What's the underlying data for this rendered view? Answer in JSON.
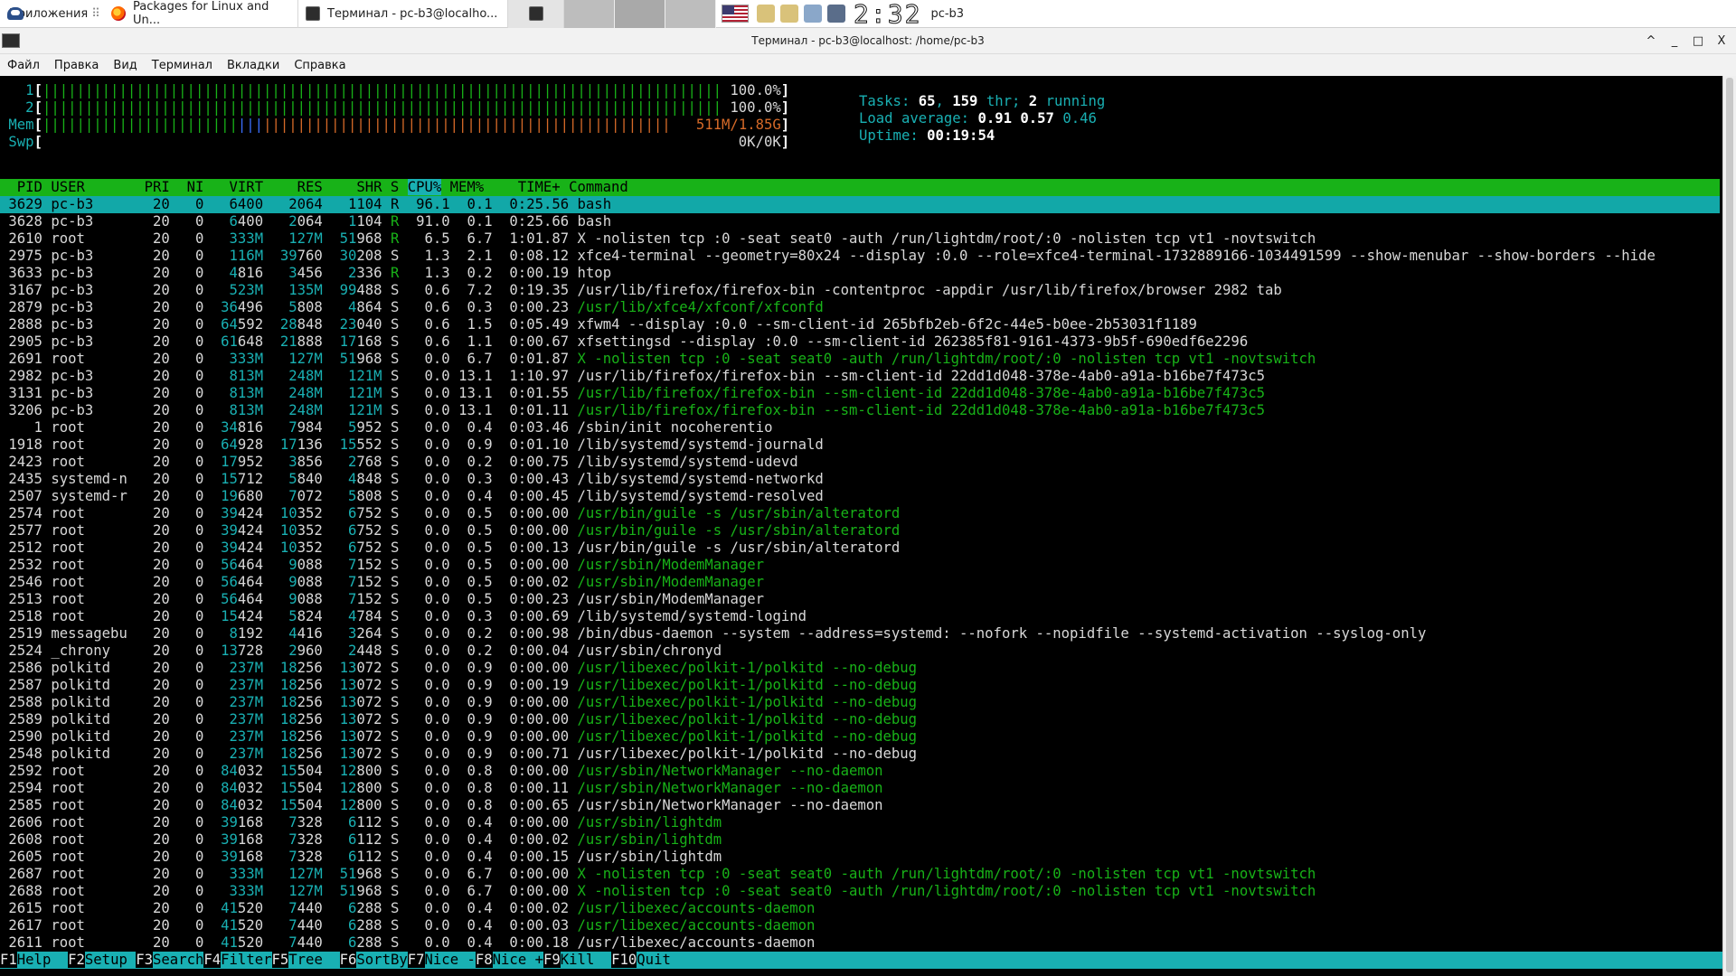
{
  "panel": {
    "apps_label": "Приложения",
    "tasks": [
      {
        "label": "Packages for Linux and Un...",
        "icon": "firefox-icon"
      },
      {
        "label": "Терминал - pc-b3@localho...",
        "icon": "terminal-icon"
      }
    ],
    "clock": "2:32",
    "user": "pc-b3"
  },
  "window": {
    "title": "Терминал - pc-b3@localhost: /home/pc-b3",
    "controls": [
      "^",
      "_",
      "□",
      "X"
    ]
  },
  "menu": [
    "Файл",
    "Правка",
    "Вид",
    "Терминал",
    "Вкладки",
    "Справка"
  ],
  "htop": {
    "cpu1": {
      "label": "1",
      "value": "100.0%"
    },
    "cpu2": {
      "label": "2",
      "value": "100.0%"
    },
    "mem": {
      "label": "Mem",
      "value": "511M/1.85G"
    },
    "swp": {
      "label": "Swp",
      "value": "0K/0K"
    },
    "tasks": "65",
    "threads": "159",
    "running": "2",
    "load1": "0.91",
    "load5": "0.57",
    "load15": "0.46",
    "uptime": "00:19:54",
    "columns": [
      "PID",
      "USER",
      "PRI",
      "NI",
      "VIRT",
      "RES",
      "SHR",
      "S",
      "CPU%",
      "MEM%",
      "TIME+",
      "Command"
    ],
    "processes": [
      {
        "pid": "3629",
        "user": "pc-b3",
        "pri": "20",
        "ni": "0",
        "virt": "6400",
        "res": "2064",
        "shr": "1104",
        "s": "R",
        "cpu": "96.1",
        "mem": "0.1",
        "time": "0:25.56",
        "cmd": "bash",
        "thread": false
      },
      {
        "pid": "3628",
        "user": "pc-b3",
        "pri": "20",
        "ni": "0",
        "virt": "6400",
        "res": "2064",
        "shr": "1104",
        "s": "R",
        "cpu": "91.0",
        "mem": "0.1",
        "time": "0:25.66",
        "cmd": "bash",
        "thread": false
      },
      {
        "pid": "2610",
        "user": "root",
        "pri": "20",
        "ni": "0",
        "virt": "333M",
        "res": "127M",
        "shr": "51968",
        "s": "R",
        "cpu": "6.5",
        "mem": "6.7",
        "time": "1:01.87",
        "cmd": "X -nolisten tcp :0 -seat seat0 -auth /run/lightdm/root/:0 -nolisten tcp vt1 -novtswitch",
        "thread": false
      },
      {
        "pid": "2975",
        "user": "pc-b3",
        "pri": "20",
        "ni": "0",
        "virt": "116M",
        "res": "39760",
        "shr": "30208",
        "s": "S",
        "cpu": "1.3",
        "mem": "2.1",
        "time": "0:08.12",
        "cmd": "xfce4-terminal --geometry=80x24 --display :0.0 --role=xfce4-terminal-1732889166-1034491599 --show-menubar --show-borders --hide",
        "thread": false
      },
      {
        "pid": "3633",
        "user": "pc-b3",
        "pri": "20",
        "ni": "0",
        "virt": "4816",
        "res": "3456",
        "shr": "2336",
        "s": "R",
        "cpu": "1.3",
        "mem": "0.2",
        "time": "0:00.19",
        "cmd": "htop",
        "thread": false
      },
      {
        "pid": "3167",
        "user": "pc-b3",
        "pri": "20",
        "ni": "0",
        "virt": "523M",
        "res": "135M",
        "shr": "99488",
        "s": "S",
        "cpu": "0.6",
        "mem": "7.2",
        "time": "0:19.35",
        "cmd": "/usr/lib/firefox/firefox-bin -contentproc -appdir /usr/lib/firefox/browser 2982 tab",
        "thread": false
      },
      {
        "pid": "2879",
        "user": "pc-b3",
        "pri": "20",
        "ni": "0",
        "virt": "36496",
        "res": "5808",
        "shr": "4864",
        "s": "S",
        "cpu": "0.6",
        "mem": "0.3",
        "time": "0:00.23",
        "cmd": "/usr/lib/xfce4/xfconf/xfconfd",
        "thread": true
      },
      {
        "pid": "2888",
        "user": "pc-b3",
        "pri": "20",
        "ni": "0",
        "virt": "64592",
        "res": "28848",
        "shr": "23040",
        "s": "S",
        "cpu": "0.6",
        "mem": "1.5",
        "time": "0:05.49",
        "cmd": "xfwm4 --display :0.0 --sm-client-id 265bfb2eb-6f2c-44e5-b0ee-2b53031f1189",
        "thread": false
      },
      {
        "pid": "2905",
        "user": "pc-b3",
        "pri": "20",
        "ni": "0",
        "virt": "61648",
        "res": "21888",
        "shr": "17168",
        "s": "S",
        "cpu": "0.6",
        "mem": "1.1",
        "time": "0:00.67",
        "cmd": "xfsettingsd --display :0.0 --sm-client-id 262385f81-9161-4373-9b5f-690edf6e2296",
        "thread": false
      },
      {
        "pid": "2691",
        "user": "root",
        "pri": "20",
        "ni": "0",
        "virt": "333M",
        "res": "127M",
        "shr": "51968",
        "s": "S",
        "cpu": "0.0",
        "mem": "6.7",
        "time": "0:01.87",
        "cmd": "X -nolisten tcp :0 -seat seat0 -auth /run/lightdm/root/:0 -nolisten tcp vt1 -novtswitch",
        "thread": true
      },
      {
        "pid": "2982",
        "user": "pc-b3",
        "pri": "20",
        "ni": "0",
        "virt": "813M",
        "res": "248M",
        "shr": "121M",
        "s": "S",
        "cpu": "0.0",
        "mem": "13.1",
        "time": "1:10.97",
        "cmd": "/usr/lib/firefox/firefox-bin --sm-client-id 22dd1d048-378e-4ab0-a91a-b16be7f473c5",
        "thread": false
      },
      {
        "pid": "3131",
        "user": "pc-b3",
        "pri": "20",
        "ni": "0",
        "virt": "813M",
        "res": "248M",
        "shr": "121M",
        "s": "S",
        "cpu": "0.0",
        "mem": "13.1",
        "time": "0:01.55",
        "cmd": "/usr/lib/firefox/firefox-bin --sm-client-id 22dd1d048-378e-4ab0-a91a-b16be7f473c5",
        "thread": true
      },
      {
        "pid": "3206",
        "user": "pc-b3",
        "pri": "20",
        "ni": "0",
        "virt": "813M",
        "res": "248M",
        "shr": "121M",
        "s": "S",
        "cpu": "0.0",
        "mem": "13.1",
        "time": "0:01.11",
        "cmd": "/usr/lib/firefox/firefox-bin --sm-client-id 22dd1d048-378e-4ab0-a91a-b16be7f473c5",
        "thread": true
      },
      {
        "pid": "1",
        "user": "root",
        "pri": "20",
        "ni": "0",
        "virt": "34816",
        "res": "7984",
        "shr": "5952",
        "s": "S",
        "cpu": "0.0",
        "mem": "0.4",
        "time": "0:03.46",
        "cmd": "/sbin/init nocoherentio",
        "thread": false
      },
      {
        "pid": "1918",
        "user": "root",
        "pri": "20",
        "ni": "0",
        "virt": "64928",
        "res": "17136",
        "shr": "15552",
        "s": "S",
        "cpu": "0.0",
        "mem": "0.9",
        "time": "0:01.10",
        "cmd": "/lib/systemd/systemd-journald",
        "thread": false
      },
      {
        "pid": "2423",
        "user": "root",
        "pri": "20",
        "ni": "0",
        "virt": "17952",
        "res": "3856",
        "shr": "2768",
        "s": "S",
        "cpu": "0.0",
        "mem": "0.2",
        "time": "0:00.75",
        "cmd": "/lib/systemd/systemd-udevd",
        "thread": false
      },
      {
        "pid": "2435",
        "user": "systemd-n",
        "pri": "20",
        "ni": "0",
        "virt": "15712",
        "res": "5840",
        "shr": "4848",
        "s": "S",
        "cpu": "0.0",
        "mem": "0.3",
        "time": "0:00.43",
        "cmd": "/lib/systemd/systemd-networkd",
        "thread": false
      },
      {
        "pid": "2507",
        "user": "systemd-r",
        "pri": "20",
        "ni": "0",
        "virt": "19680",
        "res": "7072",
        "shr": "5808",
        "s": "S",
        "cpu": "0.0",
        "mem": "0.4",
        "time": "0:00.45",
        "cmd": "/lib/systemd/systemd-resolved",
        "thread": false
      },
      {
        "pid": "2574",
        "user": "root",
        "pri": "20",
        "ni": "0",
        "virt": "39424",
        "res": "10352",
        "shr": "6752",
        "s": "S",
        "cpu": "0.0",
        "mem": "0.5",
        "time": "0:00.00",
        "cmd": "/usr/bin/guile -s /usr/sbin/alteratord",
        "thread": true
      },
      {
        "pid": "2577",
        "user": "root",
        "pri": "20",
        "ni": "0",
        "virt": "39424",
        "res": "10352",
        "shr": "6752",
        "s": "S",
        "cpu": "0.0",
        "mem": "0.5",
        "time": "0:00.00",
        "cmd": "/usr/bin/guile -s /usr/sbin/alteratord",
        "thread": true
      },
      {
        "pid": "2512",
        "user": "root",
        "pri": "20",
        "ni": "0",
        "virt": "39424",
        "res": "10352",
        "shr": "6752",
        "s": "S",
        "cpu": "0.0",
        "mem": "0.5",
        "time": "0:00.13",
        "cmd": "/usr/bin/guile -s /usr/sbin/alteratord",
        "thread": false
      },
      {
        "pid": "2532",
        "user": "root",
        "pri": "20",
        "ni": "0",
        "virt": "56464",
        "res": "9088",
        "shr": "7152",
        "s": "S",
        "cpu": "0.0",
        "mem": "0.5",
        "time": "0:00.00",
        "cmd": "/usr/sbin/ModemManager",
        "thread": true
      },
      {
        "pid": "2546",
        "user": "root",
        "pri": "20",
        "ni": "0",
        "virt": "56464",
        "res": "9088",
        "shr": "7152",
        "s": "S",
        "cpu": "0.0",
        "mem": "0.5",
        "time": "0:00.02",
        "cmd": "/usr/sbin/ModemManager",
        "thread": true
      },
      {
        "pid": "2513",
        "user": "root",
        "pri": "20",
        "ni": "0",
        "virt": "56464",
        "res": "9088",
        "shr": "7152",
        "s": "S",
        "cpu": "0.0",
        "mem": "0.5",
        "time": "0:00.23",
        "cmd": "/usr/sbin/ModemManager",
        "thread": false
      },
      {
        "pid": "2518",
        "user": "root",
        "pri": "20",
        "ni": "0",
        "virt": "15424",
        "res": "5824",
        "shr": "4784",
        "s": "S",
        "cpu": "0.0",
        "mem": "0.3",
        "time": "0:00.69",
        "cmd": "/lib/systemd/systemd-logind",
        "thread": false
      },
      {
        "pid": "2519",
        "user": "messagebu",
        "pri": "20",
        "ni": "0",
        "virt": "8192",
        "res": "4416",
        "shr": "3264",
        "s": "S",
        "cpu": "0.0",
        "mem": "0.2",
        "time": "0:00.98",
        "cmd": "/bin/dbus-daemon --system --address=systemd: --nofork --nopidfile --systemd-activation --syslog-only",
        "thread": false
      },
      {
        "pid": "2524",
        "user": "_chrony",
        "pri": "20",
        "ni": "0",
        "virt": "13728",
        "res": "2960",
        "shr": "2448",
        "s": "S",
        "cpu": "0.0",
        "mem": "0.2",
        "time": "0:00.04",
        "cmd": "/usr/sbin/chronyd",
        "thread": false
      },
      {
        "pid": "2586",
        "user": "polkitd",
        "pri": "20",
        "ni": "0",
        "virt": "237M",
        "res": "18256",
        "shr": "13072",
        "s": "S",
        "cpu": "0.0",
        "mem": "0.9",
        "time": "0:00.00",
        "cmd": "/usr/libexec/polkit-1/polkitd --no-debug",
        "thread": true
      },
      {
        "pid": "2587",
        "user": "polkitd",
        "pri": "20",
        "ni": "0",
        "virt": "237M",
        "res": "18256",
        "shr": "13072",
        "s": "S",
        "cpu": "0.0",
        "mem": "0.9",
        "time": "0:00.19",
        "cmd": "/usr/libexec/polkit-1/polkitd --no-debug",
        "thread": true
      },
      {
        "pid": "2588",
        "user": "polkitd",
        "pri": "20",
        "ni": "0",
        "virt": "237M",
        "res": "18256",
        "shr": "13072",
        "s": "S",
        "cpu": "0.0",
        "mem": "0.9",
        "time": "0:00.00",
        "cmd": "/usr/libexec/polkit-1/polkitd --no-debug",
        "thread": true
      },
      {
        "pid": "2589",
        "user": "polkitd",
        "pri": "20",
        "ni": "0",
        "virt": "237M",
        "res": "18256",
        "shr": "13072",
        "s": "S",
        "cpu": "0.0",
        "mem": "0.9",
        "time": "0:00.00",
        "cmd": "/usr/libexec/polkit-1/polkitd --no-debug",
        "thread": true
      },
      {
        "pid": "2590",
        "user": "polkitd",
        "pri": "20",
        "ni": "0",
        "virt": "237M",
        "res": "18256",
        "shr": "13072",
        "s": "S",
        "cpu": "0.0",
        "mem": "0.9",
        "time": "0:00.00",
        "cmd": "/usr/libexec/polkit-1/polkitd --no-debug",
        "thread": true
      },
      {
        "pid": "2548",
        "user": "polkitd",
        "pri": "20",
        "ni": "0",
        "virt": "237M",
        "res": "18256",
        "shr": "13072",
        "s": "S",
        "cpu": "0.0",
        "mem": "0.9",
        "time": "0:00.71",
        "cmd": "/usr/libexec/polkit-1/polkitd --no-debug",
        "thread": false
      },
      {
        "pid": "2592",
        "user": "root",
        "pri": "20",
        "ni": "0",
        "virt": "84032",
        "res": "15504",
        "shr": "12800",
        "s": "S",
        "cpu": "0.0",
        "mem": "0.8",
        "time": "0:00.00",
        "cmd": "/usr/sbin/NetworkManager --no-daemon",
        "thread": true
      },
      {
        "pid": "2594",
        "user": "root",
        "pri": "20",
        "ni": "0",
        "virt": "84032",
        "res": "15504",
        "shr": "12800",
        "s": "S",
        "cpu": "0.0",
        "mem": "0.8",
        "time": "0:00.11",
        "cmd": "/usr/sbin/NetworkManager --no-daemon",
        "thread": true
      },
      {
        "pid": "2585",
        "user": "root",
        "pri": "20",
        "ni": "0",
        "virt": "84032",
        "res": "15504",
        "shr": "12800",
        "s": "S",
        "cpu": "0.0",
        "mem": "0.8",
        "time": "0:00.65",
        "cmd": "/usr/sbin/NetworkManager --no-daemon",
        "thread": false
      },
      {
        "pid": "2606",
        "user": "root",
        "pri": "20",
        "ni": "0",
        "virt": "39168",
        "res": "7328",
        "shr": "6112",
        "s": "S",
        "cpu": "0.0",
        "mem": "0.4",
        "time": "0:00.00",
        "cmd": "/usr/sbin/lightdm",
        "thread": true
      },
      {
        "pid": "2608",
        "user": "root",
        "pri": "20",
        "ni": "0",
        "virt": "39168",
        "res": "7328",
        "shr": "6112",
        "s": "S",
        "cpu": "0.0",
        "mem": "0.4",
        "time": "0:00.02",
        "cmd": "/usr/sbin/lightdm",
        "thread": true
      },
      {
        "pid": "2605",
        "user": "root",
        "pri": "20",
        "ni": "0",
        "virt": "39168",
        "res": "7328",
        "shr": "6112",
        "s": "S",
        "cpu": "0.0",
        "mem": "0.4",
        "time": "0:00.15",
        "cmd": "/usr/sbin/lightdm",
        "thread": false
      },
      {
        "pid": "2687",
        "user": "root",
        "pri": "20",
        "ni": "0",
        "virt": "333M",
        "res": "127M",
        "shr": "51968",
        "s": "S",
        "cpu": "0.0",
        "mem": "6.7",
        "time": "0:00.00",
        "cmd": "X -nolisten tcp :0 -seat seat0 -auth /run/lightdm/root/:0 -nolisten tcp vt1 -novtswitch",
        "thread": true
      },
      {
        "pid": "2688",
        "user": "root",
        "pri": "20",
        "ni": "0",
        "virt": "333M",
        "res": "127M",
        "shr": "51968",
        "s": "S",
        "cpu": "0.0",
        "mem": "6.7",
        "time": "0:00.00",
        "cmd": "X -nolisten tcp :0 -seat seat0 -auth /run/lightdm/root/:0 -nolisten tcp vt1 -novtswitch",
        "thread": true
      },
      {
        "pid": "2615",
        "user": "root",
        "pri": "20",
        "ni": "0",
        "virt": "41520",
        "res": "7440",
        "shr": "6288",
        "s": "S",
        "cpu": "0.0",
        "mem": "0.4",
        "time": "0:00.02",
        "cmd": "/usr/libexec/accounts-daemon",
        "thread": true
      },
      {
        "pid": "2617",
        "user": "root",
        "pri": "20",
        "ni": "0",
        "virt": "41520",
        "res": "7440",
        "shr": "6288",
        "s": "S",
        "cpu": "0.0",
        "mem": "0.4",
        "time": "0:00.03",
        "cmd": "/usr/libexec/accounts-daemon",
        "thread": true
      },
      {
        "pid": "2611",
        "user": "root",
        "pri": "20",
        "ni": "0",
        "virt": "41520",
        "res": "7440",
        "shr": "6288",
        "s": "S",
        "cpu": "0.0",
        "mem": "0.4",
        "time": "0:00.18",
        "cmd": "/usr/libexec/accounts-daemon",
        "thread": false
      }
    ],
    "fkeys": [
      {
        "key": "F1",
        "label": "Help  "
      },
      {
        "key": "F2",
        "label": "Setup "
      },
      {
        "key": "F3",
        "label": "Search"
      },
      {
        "key": "F4",
        "label": "Filter"
      },
      {
        "key": "F5",
        "label": "Tree  "
      },
      {
        "key": "F6",
        "label": "SortBy"
      },
      {
        "key": "F7",
        "label": "Nice -"
      },
      {
        "key": "F8",
        "label": "Nice +"
      },
      {
        "key": "F9",
        "label": "Kill  "
      },
      {
        "key": "F10",
        "label": "Quit"
      }
    ]
  },
  "colors": {
    "terminal_bg": "#000000",
    "header_green": "#18b218",
    "cyan": "#19b0b3",
    "selected_row": "#12a8a8"
  }
}
